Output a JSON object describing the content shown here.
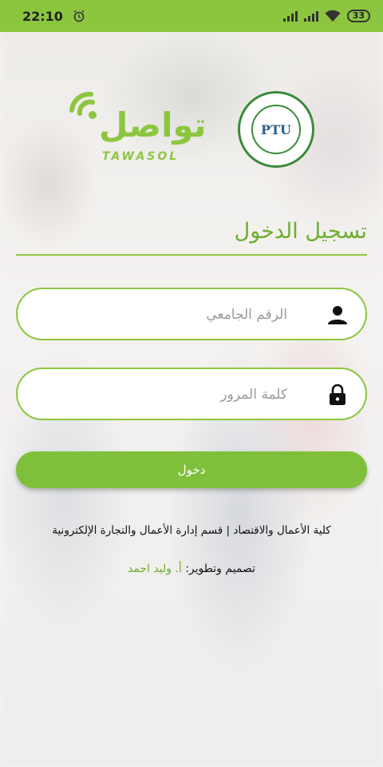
{
  "status_bar": {
    "time": "22:10",
    "battery": "33",
    "icons": [
      "alarm-icon",
      "signal-icon",
      "signal-icon",
      "wifi-icon",
      "battery-icon"
    ]
  },
  "branding": {
    "app_logo_text": "تواصل",
    "app_logo_latin": "TAWASOL",
    "university_seal_text": "PTU",
    "university_name_en": "Palestine Technical University"
  },
  "login": {
    "title": "تسجيل الدخول",
    "student_id_placeholder": "الرقم الجامعي",
    "student_id_value": "",
    "password_placeholder": "كلمة المرور",
    "password_value": "",
    "submit_label": "دخول"
  },
  "footer": {
    "department": "كلية الأعمال والاقتصاد | قسم إدارة الأعمال والتجارة الإلكترونية",
    "credit_prefix": "تصميم وتطوير:",
    "credit_name": "أ. وليد احمد"
  },
  "colors": {
    "accent": "#8cc63f",
    "accent_text": "#6dae2e"
  }
}
